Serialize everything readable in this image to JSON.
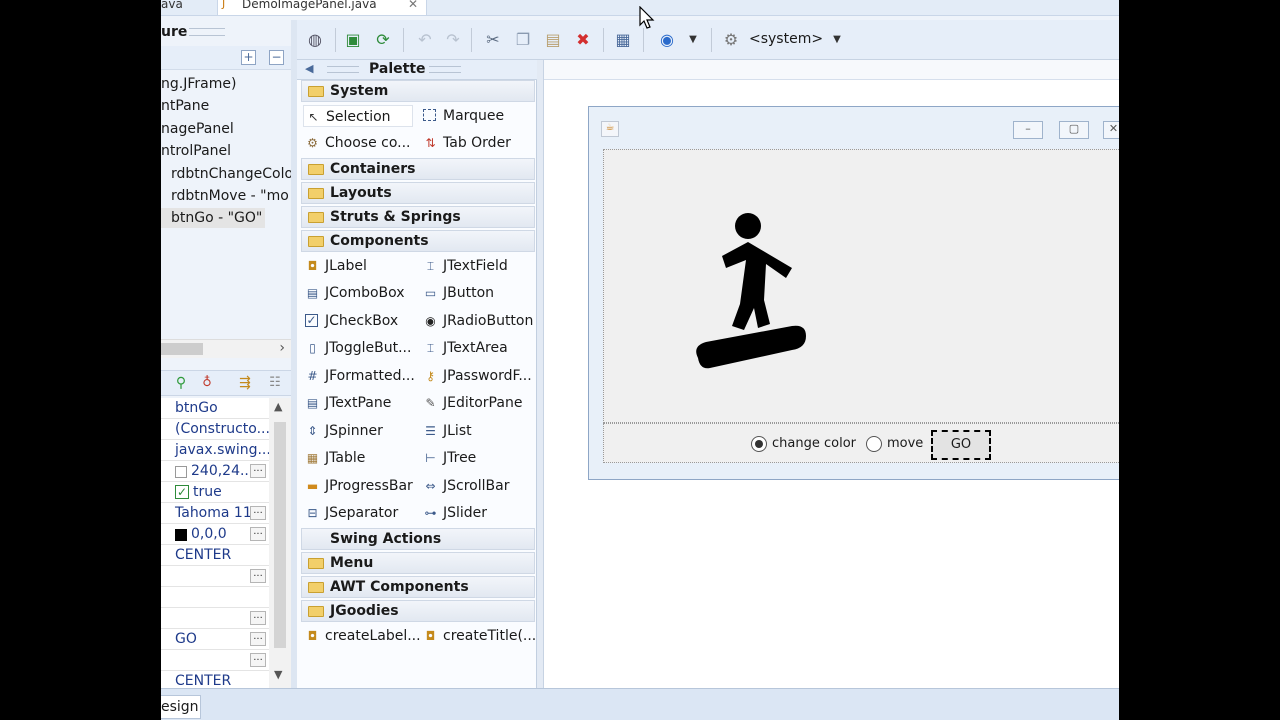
{
  "tabs": {
    "first": "ava",
    "active": "DemoImagePanel.java"
  },
  "structure": {
    "title": "ure",
    "items": [
      "ng.JFrame)",
      "ntPane",
      "nagePanel",
      "ntrolPanel",
      "rdbtnChangeColo",
      "rdbtnMove - \"mo",
      "btnGo - \"GO\""
    ]
  },
  "properties": {
    "rows": [
      {
        "value": "btnGo",
        "ellipsis": false
      },
      {
        "value": "(Constructo...",
        "ellipsis": false
      },
      {
        "value": "javax.swing....",
        "ellipsis": false
      },
      {
        "value": "240,24...",
        "ellipsis": true
      },
      {
        "value": "true",
        "ellipsis": false
      },
      {
        "value": "Tahoma 11",
        "ellipsis": true
      },
      {
        "value": "0,0,0",
        "ellipsis": true
      },
      {
        "value": "CENTER",
        "ellipsis": false
      },
      {
        "value": "",
        "ellipsis": true
      },
      {
        "value": "",
        "ellipsis": false
      },
      {
        "value": "",
        "ellipsis": true
      },
      {
        "value": "GO",
        "ellipsis": true
      },
      {
        "value": "",
        "ellipsis": true
      },
      {
        "value": "CENTER",
        "ellipsis": false
      }
    ]
  },
  "toolbar": {
    "system_label": "<system>"
  },
  "palette": {
    "title": "Palette",
    "cat_system": "System",
    "selection": "Selection",
    "marquee": "Marquee",
    "choose": "Choose co...",
    "tab_order": "Tab Order",
    "cat_containers": "Containers",
    "cat_layouts": "Layouts",
    "cat_struts": "Struts & Springs",
    "cat_components": "Components",
    "components_left": [
      "JLabel",
      "JComboBox",
      "JCheckBox",
      "JToggleBut...",
      "JFormatted...",
      "JTextPane",
      "JSpinner",
      "JTable",
      "JProgressBar",
      "JSeparator"
    ],
    "components_right": [
      "JTextField",
      "JButton",
      "JRadioButton",
      "JTextArea",
      "JPasswordF...",
      "JEditorPane",
      "JList",
      "JTree",
      "JScrollBar",
      "JSlider"
    ],
    "cat_swing_actions": "Swing Actions",
    "cat_menu": "Menu",
    "cat_awt": "AWT Components",
    "cat_jgoodies": "JGoodies",
    "create_label": "createLabel...",
    "create_title": "createTitle(..."
  },
  "design": {
    "radio_change_color": "change color",
    "radio_move": "move",
    "go_button": "GO",
    "change_color_selected": true
  },
  "status": {
    "design_tab": "esign"
  },
  "colors": {
    "accent": "#1e3a8a",
    "delete_red": "#d32f2f",
    "folder": "#f2cf6a"
  }
}
